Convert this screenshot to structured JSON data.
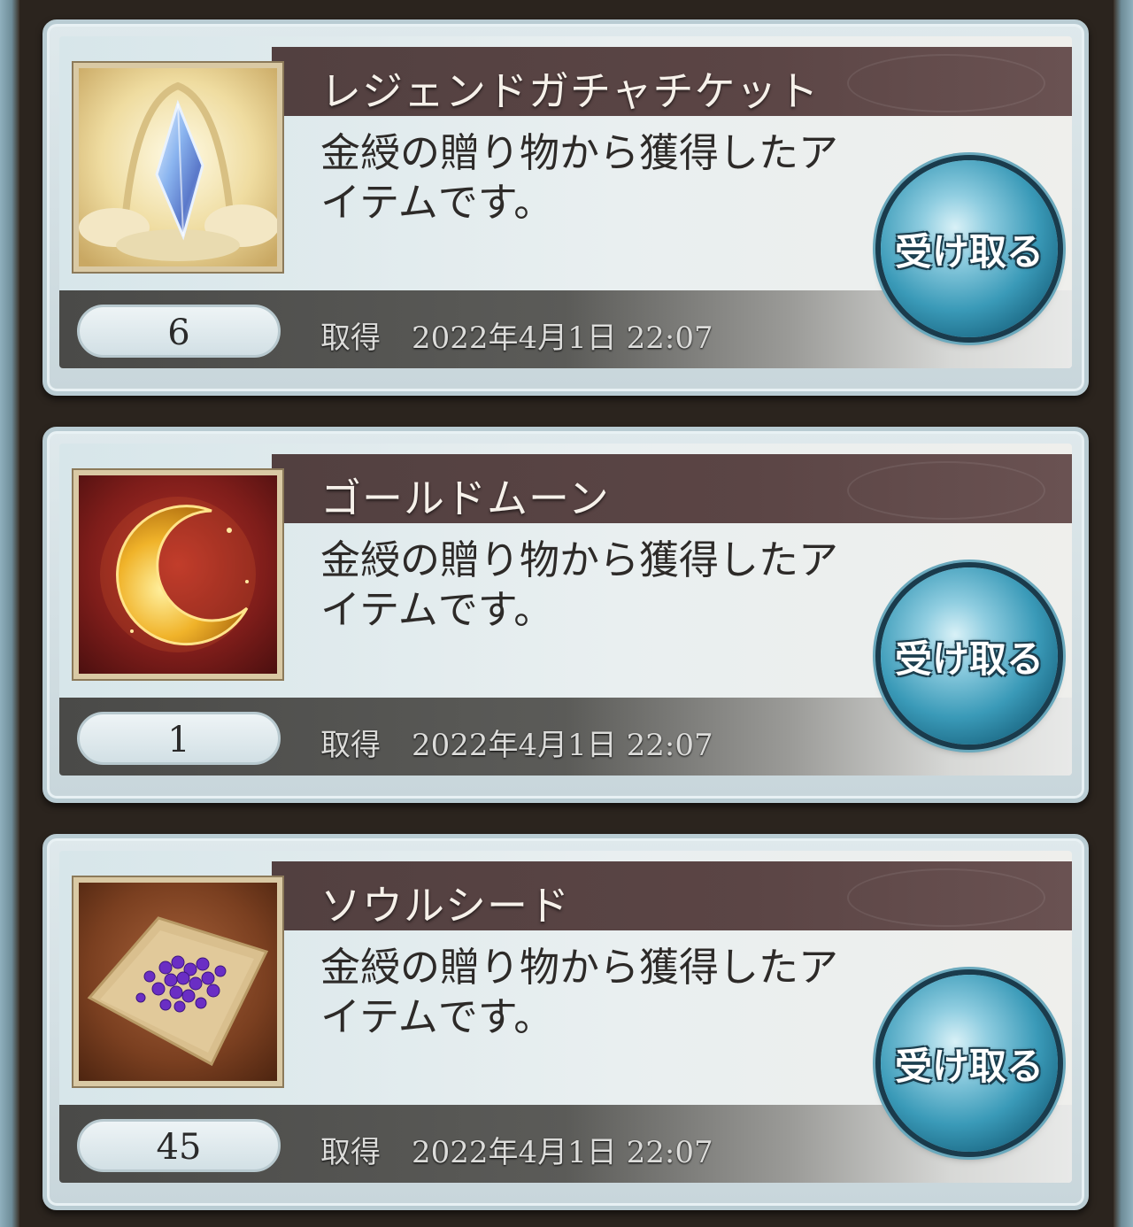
{
  "items": [
    {
      "name": "レジェンドガチャチケット",
      "description": "金綬の贈り物から獲得したアイテムです。",
      "count": "6",
      "acquired_label": "取得",
      "acquired_date": "2022年4月1日 22:07",
      "button_label": "受け取る",
      "icon": "legend-gacha-ticket-icon"
    },
    {
      "name": "ゴールドムーン",
      "description": "金綬の贈り物から獲得したアイテムです。",
      "count": "1",
      "acquired_label": "取得",
      "acquired_date": "2022年4月1日 22:07",
      "button_label": "受け取る",
      "icon": "gold-moon-icon"
    },
    {
      "name": "ソウルシード",
      "description": "金綬の贈り物から獲得したアイテムです。",
      "count": "45",
      "acquired_label": "取得",
      "acquired_date": "2022年4月1日 22:07",
      "button_label": "受け取る",
      "icon": "soul-seed-icon"
    }
  ]
}
